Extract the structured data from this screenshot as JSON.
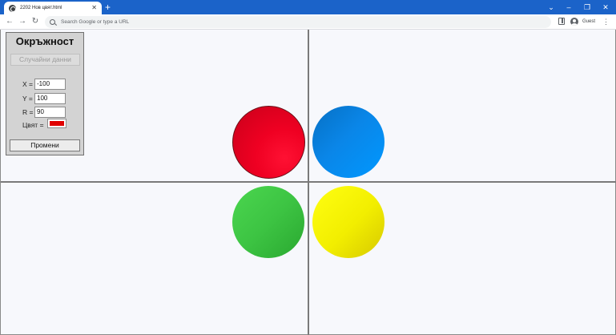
{
  "browser": {
    "tab_title": "2202 Нов цвят.html",
    "tab_close": "✕",
    "new_tab": "+",
    "omnibox_placeholder": "Search Google or type a URL",
    "profile_label": "Guest",
    "nav": {
      "back": "←",
      "forward": "→",
      "reload": "↻"
    },
    "window_controls": {
      "tab_search": "⌄",
      "minimize": "–",
      "maximize": "❐",
      "close": "✕"
    },
    "menu": "⋮",
    "titlebar_color": "#1b63c9"
  },
  "panel": {
    "title": "Окръжност",
    "random_button": "Случайни данни",
    "x_label": "X =",
    "x_value": "-100",
    "y_label": "Y =",
    "y_value": "100",
    "r_label": "R =",
    "r_value": "90",
    "color_label": "Цвят =",
    "color_value": "#e00000",
    "change_button": "Промени"
  },
  "canvas": {
    "circles": [
      {
        "name": "red",
        "color": "#ef0022"
      },
      {
        "name": "blue",
        "color": "#0a86e8"
      },
      {
        "name": "green",
        "color": "#3dc443"
      },
      {
        "name": "yellow",
        "color": "#f2ee00"
      }
    ]
  }
}
